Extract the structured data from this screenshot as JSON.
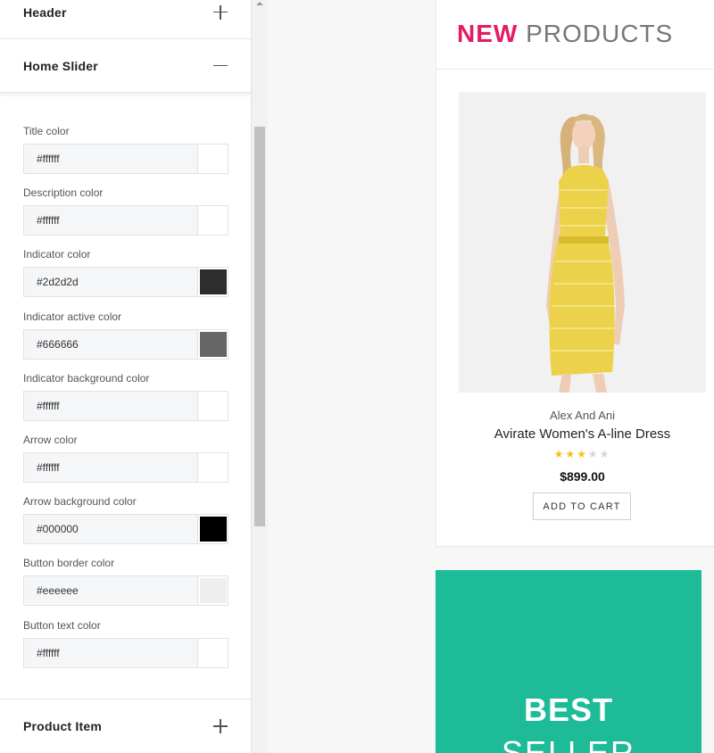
{
  "panel": {
    "sections": {
      "header": "Header",
      "home_slider": "Home Slider",
      "product_item": "Product Item"
    },
    "fields": [
      {
        "label": "Title color",
        "value": "#ffffff",
        "swatch": "#ffffff"
      },
      {
        "label": "Description color",
        "value": "#ffffff",
        "swatch": "#ffffff"
      },
      {
        "label": "Indicator color",
        "value": "#2d2d2d",
        "swatch": "#2d2d2d"
      },
      {
        "label": "Indicator active color",
        "value": "#666666",
        "swatch": "#666666"
      },
      {
        "label": "Indicator background color",
        "value": "#ffffff",
        "swatch": "#ffffff"
      },
      {
        "label": "Arrow color",
        "value": "#ffffff",
        "swatch": "#ffffff"
      },
      {
        "label": "Arrow background color",
        "value": "#000000",
        "swatch": "#000000"
      },
      {
        "label": "Button border color",
        "value": "#eeeeee",
        "swatch": "#eeeeee"
      },
      {
        "label": "Button text color",
        "value": "#ffffff",
        "swatch": "#ffffff"
      }
    ]
  },
  "preview": {
    "new_products": {
      "title_highlight": "NEW",
      "title_rest": "PRODUCTS",
      "accent_color": "#e41c66"
    },
    "product": {
      "brand": "Alex And Ani",
      "name": "Avirate Women's A-line Dress",
      "rating": 3,
      "rating_max": 5,
      "price": "$899.00",
      "cta": "ADD TO CART"
    },
    "best_seller": {
      "line1": "BEST",
      "line2": "SELLER",
      "bg_color": "#1dbb98"
    }
  }
}
